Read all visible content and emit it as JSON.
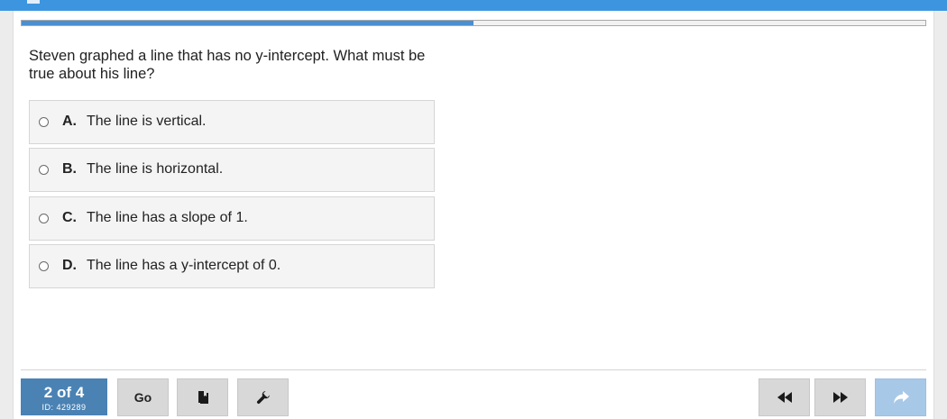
{
  "progress": {
    "fraction": 0.5
  },
  "question": {
    "prompt": "Steven graphed a line that has no y-intercept. What must be true about his line?"
  },
  "choices": [
    {
      "letter": "A.",
      "text": "The line is vertical."
    },
    {
      "letter": "B.",
      "text": "The line is horizontal."
    },
    {
      "letter": "C.",
      "text": "The line has a slope of 1."
    },
    {
      "letter": "D.",
      "text": "The line has a y-intercept of 0."
    }
  ],
  "footer": {
    "counter": "2 of 4",
    "question_id": "ID: 429289",
    "go_label": "Go",
    "icons": {
      "book": "book-icon",
      "tools": "wrench-icon",
      "prev": "rewind-icon",
      "next": "fast-forward-icon",
      "submit": "forward-arrow-icon"
    }
  },
  "colors": {
    "topbar": "#3d95e0",
    "progress_fill": "#4a8fd2",
    "counter_bg": "#4a82b4",
    "button_bg": "#d8d8d8",
    "submit_bg": "#a8c8e8"
  }
}
